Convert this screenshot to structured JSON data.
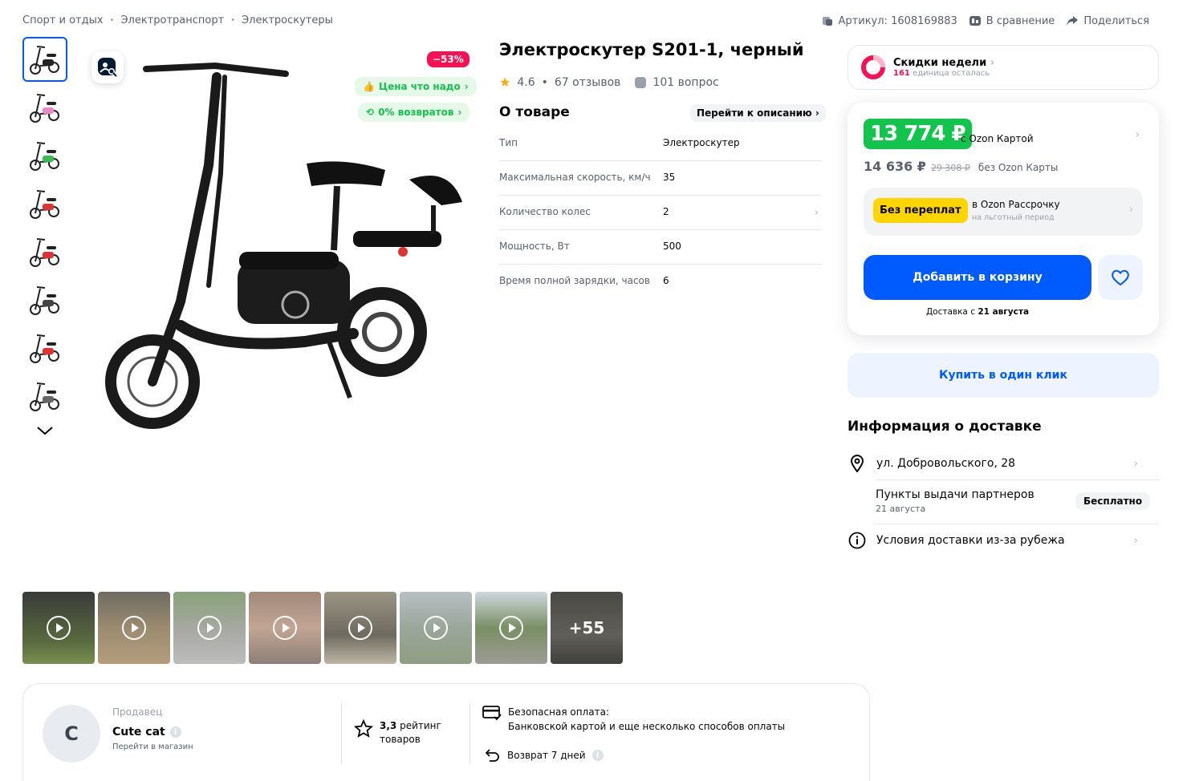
{
  "breadcrumb": [
    "Спорт и отдых",
    "Электротранспорт",
    "Электроскутеры"
  ],
  "top_actions": {
    "article": "Артикул: 1608169883",
    "compare": "В сравнение",
    "share": "Поделиться"
  },
  "gallery": {
    "discount": "−53%",
    "price_badge": "Цена что надо",
    "returns_badge": "0% возвратов",
    "thumb_count": 8
  },
  "product": {
    "title": "Электроскутер S201-1, черный",
    "rating": "4.6",
    "reviews": "67 отзывов",
    "questions": "101 вопрос"
  },
  "about": {
    "heading": "О товаре",
    "go_desc": "Перейти к описанию",
    "specs": [
      {
        "key": "Тип",
        "value": "Электроскутер"
      },
      {
        "key": "Максимальная скорость, км/ч",
        "value": "35"
      },
      {
        "key": "Количество колес",
        "value": "2"
      },
      {
        "key": "Мощность, Вт",
        "value": "500"
      },
      {
        "key": "Время полной зарядки, часов",
        "value": "6"
      }
    ]
  },
  "week_sale": {
    "title": "Скидки недели",
    "count": "161",
    "left": "единица осталась"
  },
  "price": {
    "ozon_price": "13 774 ₽",
    "ozon_label": "с Ozon Картой",
    "normal_price": "14 636 ₽",
    "old_price": "29 308 ₽",
    "no_card": "без Ozon Карты",
    "no_overpay": "Без переплат",
    "installment_title": "в Ozon Рассрочку",
    "installment_sub": "на льготный период",
    "add_to_cart": "Добавить в корзину",
    "delivery_prefix": "Доставка с",
    "delivery_date": "21 августа"
  },
  "one_click": "Купить в один клик",
  "delivery": {
    "heading": "Информация о доставке",
    "address": "ул. Добровольского, 28",
    "pickup": "Пункты выдачи партнеров",
    "pickup_date": "21 августа",
    "free": "Бесплатно",
    "abroad": "Условия доставки из-за рубежа"
  },
  "videos": {
    "more": "+55"
  },
  "seller": {
    "label": "Продавец",
    "initial": "C",
    "name": "Cute cat",
    "link": "Перейти в магазин",
    "rating_value": "3,3",
    "rating_text": "рейтинг",
    "rating_sub": "товаров",
    "pay_title": "Безопасная оплата:",
    "pay_desc": "Банковской картой и еще несколько способов оплаты",
    "return": "Возврат 7 дней"
  },
  "colors": {
    "accent": "#005bff",
    "green": "#10c44c",
    "pink": "#f91155",
    "yellow": "#ffd500"
  }
}
